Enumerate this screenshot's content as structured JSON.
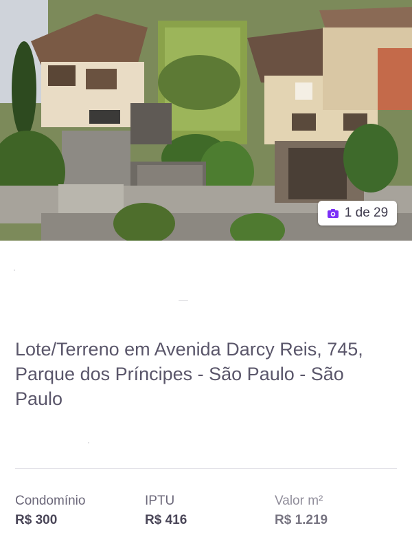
{
  "photo": {
    "counter_text": "1 de 29",
    "counter_icon": "camera-icon",
    "accent_color": "#7b2ff7"
  },
  "listing": {
    "title": "Lote/Terreno em Avenida Darcy Reis, 745, Parque dos Príncipes - São Paulo - São Paulo"
  },
  "stats": [
    {
      "label": "Condomínio",
      "value": "R$ 300"
    },
    {
      "label": "IPTU",
      "value": "R$ 416"
    },
    {
      "label": "Valor m²",
      "value": "R$ 1.219"
    }
  ]
}
